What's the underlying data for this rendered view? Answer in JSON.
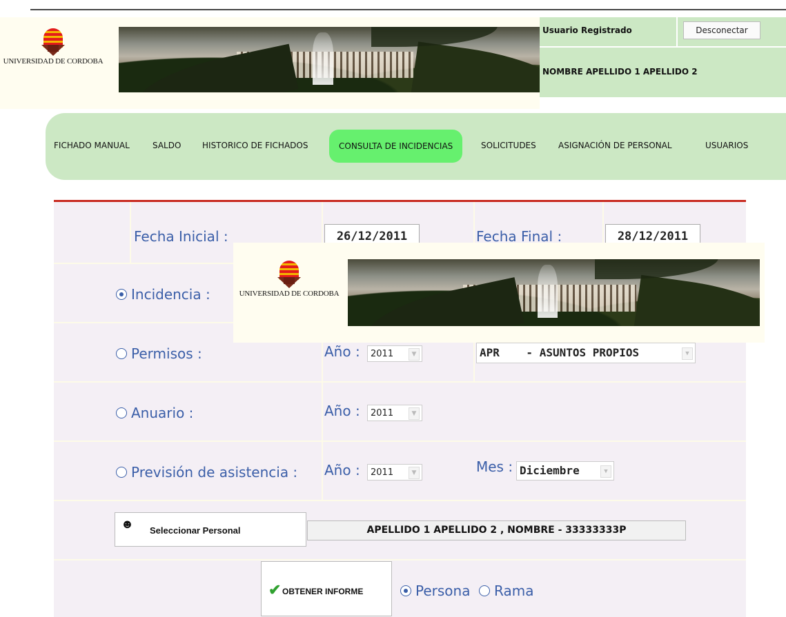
{
  "header": {
    "logo_text": "UNIVERSIDAD DE CORDOBA",
    "user_label": "Usuario Registrado",
    "disconnect_label": "Desconectar",
    "user_name": "NOMBRE APELLIDO 1 APELLIDO 2"
  },
  "nav": {
    "items": [
      {
        "label": "FICHADO MANUAL"
      },
      {
        "label": "SALDO"
      },
      {
        "label": "HISTORICO DE FICHADOS"
      },
      {
        "label": "CONSULTA DE INCIDENCIAS",
        "active": true
      },
      {
        "label": "SOLICITUDES"
      },
      {
        "label": "ASIGNACIÓN DE PERSONAL"
      },
      {
        "label": "USUARIOS"
      }
    ]
  },
  "form": {
    "fecha_inicial_label": "Fecha Inicial :",
    "fecha_inicial_value": "26/12/2011",
    "fecha_final_label": "Fecha Final :",
    "fecha_final_value": "28/12/2011",
    "incidencia_label": "Incidencia :",
    "permisos_label": "Permisos :",
    "permisos_anio_label": "Año :",
    "permisos_anio_value": "2011",
    "permisos_tipo_value": "APR    - ASUNTOS PROPIOS",
    "anuario_label": "Anuario :",
    "anuario_anio_label": "Año :",
    "anuario_anio_value": "2011",
    "prevision_label": "Previsión de asistencia :",
    "prevision_anio_label": "Año :",
    "prevision_anio_value": "2011",
    "prevision_mes_label": "Mes :",
    "prevision_mes_value": "Diciembre",
    "seleccionar_personal_label": "Seleccionar Personal",
    "selected_person": "APELLIDO 1 APELLIDO 2 , NOMBRE - 33333333P",
    "obtener_informe_label": "OBTENER INFORME",
    "persona_label": "Persona",
    "rama_label": "Rama",
    "selected_mode": "incidencia",
    "selected_scope": "persona"
  },
  "popup": {
    "logo_text": "UNIVERSIDAD DE CORDOBA"
  }
}
